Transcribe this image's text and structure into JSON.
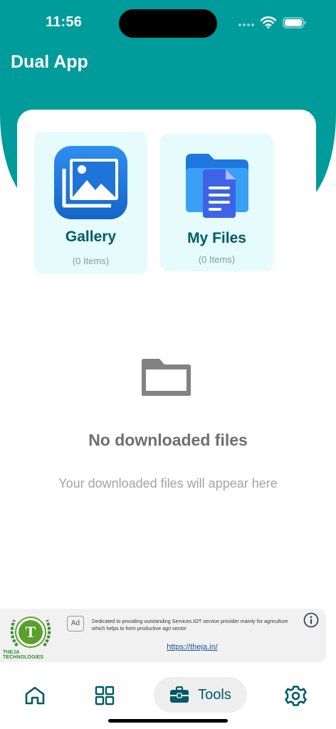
{
  "status_bar": {
    "time": "11:56"
  },
  "header": {
    "title": "Dual App"
  },
  "tiles": [
    {
      "title": "Gallery",
      "count": "(0 Items)"
    },
    {
      "title": "My Files",
      "count": "(0 Items)"
    }
  ],
  "empty_state": {
    "title": "No downloaded files",
    "subtitle": "Your downloaded files will appear here"
  },
  "ad": {
    "tag": "Ad",
    "brand": "THEJA TECHNOLOGIES",
    "logo_letter": "T",
    "description": "Dedicated to providing outstanding Services.IOT service provider mainly for agriculture which helps to form productive agri sector",
    "link": "https://theja.in/"
  },
  "nav": {
    "items": [
      {
        "icon": "home-icon"
      },
      {
        "icon": "grid-icon"
      },
      {
        "icon": "toolbox-icon",
        "label": "Tools",
        "active": true
      },
      {
        "icon": "gear-icon"
      }
    ]
  },
  "colors": {
    "header_bg": "#009b9b",
    "accent": "#005a66",
    "tile_bg": "#e5fbfc"
  }
}
